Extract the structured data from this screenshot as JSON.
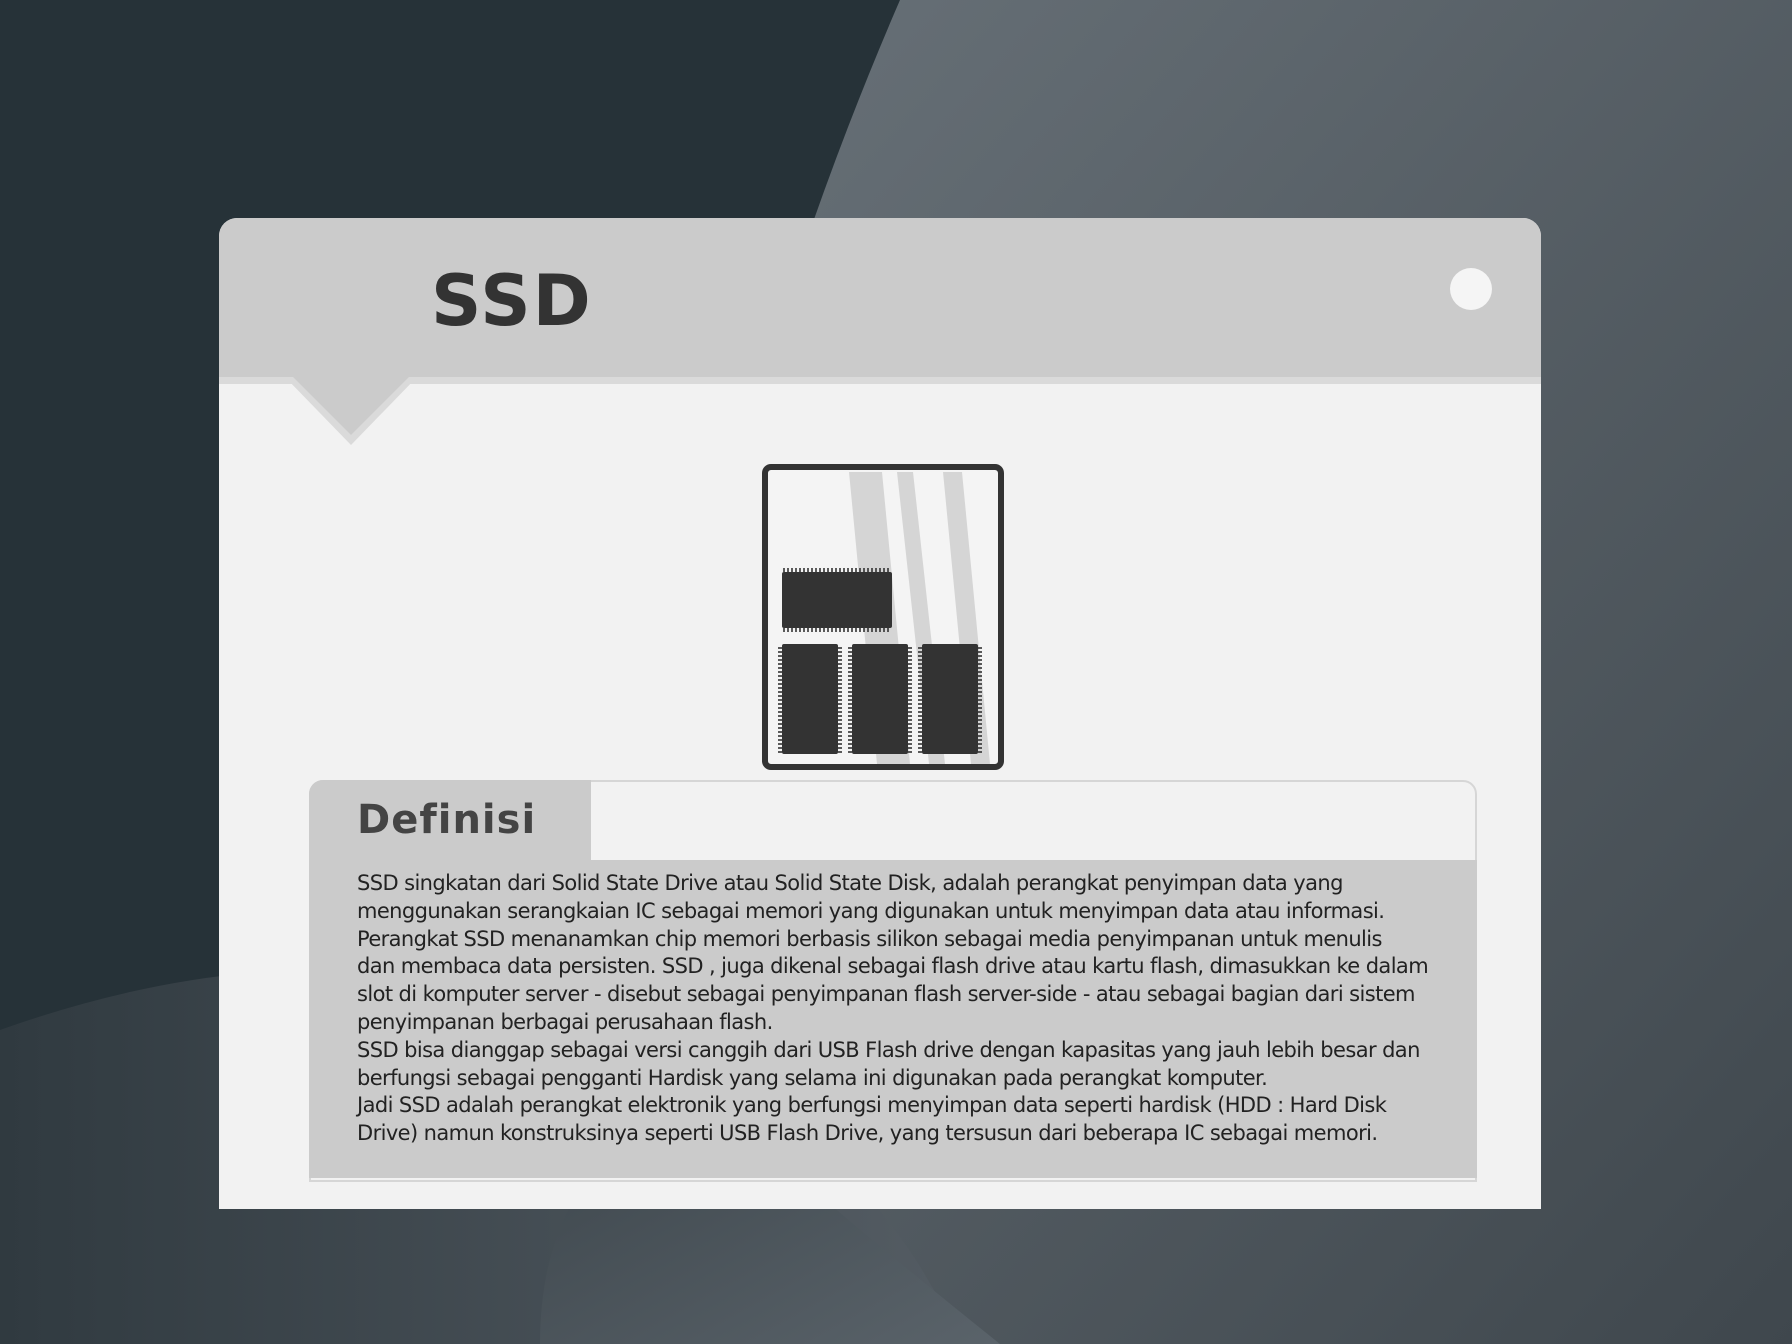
{
  "title": "SSD",
  "icon": "ssd-chip-icon",
  "colors": {
    "background_dark": "#263238",
    "background_mid": "#4b5359",
    "header": "#cbcbcb",
    "card": "#f2f2f2",
    "text_dark": "#333333"
  },
  "definition": {
    "heading": "Definisi",
    "lines": [
      "SSD singkatan dari Solid State Drive atau Solid State Disk, adalah perangkat penyimpan data yang",
      "menggunakan serangkaian IC sebagai memori yang digunakan untuk menyimpan data atau informasi.",
      "Perangkat SSD menanamkan chip memori berbasis silikon sebagai media penyimpanan untuk menulis",
      "dan membaca data persisten. SSD , juga dikenal sebagai flash drive atau kartu flash, dimasukkan ke dalam",
      "slot di komputer server - disebut sebagai penyimpanan flash server-side - atau sebagai bagian dari sistem",
      "penyimpanan berbagai perusahaan flash.",
      "SSD bisa dianggap sebagai versi canggih dari USB Flash drive dengan kapasitas yang jauh lebih besar dan",
      "berfungsi sebagai pengganti Hardisk yang selama ini digunakan pada perangkat komputer.",
      "Jadi SSD adalah perangkat elektronik yang berfungsi menyimpan data seperti hardisk (HDD : Hard Disk",
      "Drive) namun konstruksinya seperti USB Flash Drive, yang tersusun dari beberapa IC sebagai memori."
    ]
  }
}
